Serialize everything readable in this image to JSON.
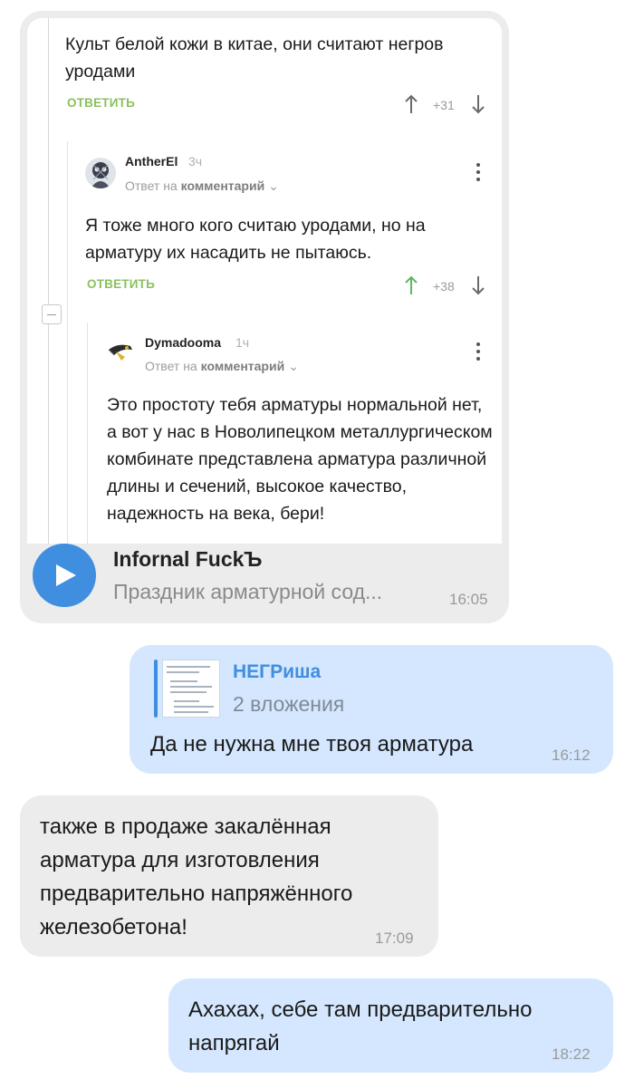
{
  "messages": {
    "forwarded": {
      "comments": [
        {
          "text": "Культ белой кожи в китае, они считают негров уродами",
          "reply_label": "ОТВЕТИТЬ",
          "rating": "+31"
        },
        {
          "author": "AntherEl",
          "time": "3ч",
          "reply_to_prefix": "Ответ на",
          "reply_to_target": "комментарий",
          "text": "Я тоже много кого считаю уродами, но на арматуру их насадить не пытаюсь.",
          "reply_label": "ОТВЕТИТЬ",
          "rating": "+38"
        },
        {
          "author": "Dymadooma",
          "time": "1ч",
          "reply_to_prefix": "Ответ на",
          "reply_to_target": "комментарий",
          "text": "Это простоту тебя арматуры нормальной нет, а вот у нас в Новолипецком металлургическом комбинате представлена арматура различной длины и сечений, высокое качество, надежность на века, бери!"
        }
      ],
      "sender": "Infornal FuckЪ",
      "subtitle": "Праздник арматурной сод...",
      "time": "16:05"
    },
    "outgoing_reply": {
      "quote_name": "НЕГРиша",
      "quote_subtitle": "2 вложения",
      "text": "Да не нужна мне твоя арматура",
      "time": "16:12"
    },
    "incoming_2": {
      "text": "также в продаже закалённая арматура для изготовления предварительно напряжённого железобетона!",
      "time": "17:09"
    },
    "outgoing_2": {
      "text": "Ахахах, себе там предварительно напрягай",
      "time": "18:22"
    }
  },
  "colors": {
    "incoming_bubble": "#ececec",
    "outgoing_bubble": "#d4e7fe",
    "accent_blue": "#3f8ee0",
    "reply_green": "#8ac15d",
    "upvote_active": "#5cb85c"
  }
}
